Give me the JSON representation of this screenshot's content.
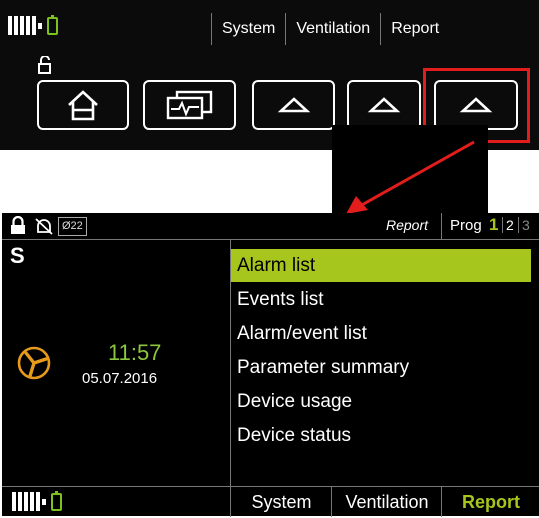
{
  "top_panel": {
    "tabs": [
      {
        "label": "System"
      },
      {
        "label": "Ventilation"
      },
      {
        "label": "Report"
      }
    ],
    "soft_keys": [
      {
        "icon": "home-icon"
      },
      {
        "icon": "monitor-icon"
      },
      {
        "icon": "up-arrow-icon"
      },
      {
        "icon": "up-arrow-icon"
      },
      {
        "icon": "up-arrow-icon"
      }
    ],
    "highlight_color": "#e31c1c"
  },
  "screen": {
    "status": {
      "icons": [
        "lock-icon",
        "alarm-muted-icon"
      ],
      "o2_label": "Ø22",
      "context": "Report",
      "prog_label": "Prog",
      "prog_pages": [
        "1",
        "2",
        "3"
      ],
      "active_prog_page": "1"
    },
    "mode_letter": "S",
    "time": "11:57",
    "date": "05.07.2016",
    "menu": [
      {
        "label": "Alarm list",
        "selected": true
      },
      {
        "label": "Events list",
        "selected": false
      },
      {
        "label": "Alarm/event list",
        "selected": false
      },
      {
        "label": "Parameter summary",
        "selected": false
      },
      {
        "label": "Device usage",
        "selected": false
      },
      {
        "label": "Device status",
        "selected": false
      }
    ],
    "bottom_tabs": [
      {
        "label": "System"
      },
      {
        "label": "Ventilation"
      },
      {
        "label": "Report",
        "active": true
      }
    ],
    "accent_color": "#a6c51d",
    "time_color": "#8cc63f"
  }
}
